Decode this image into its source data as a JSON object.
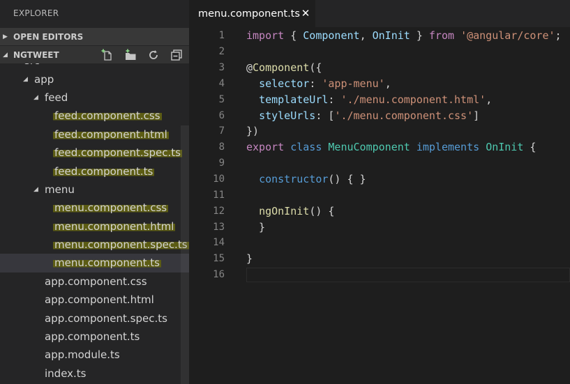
{
  "explorer": {
    "title": "EXPLORER",
    "open_editors": "OPEN EDITORS",
    "project": "NGTWEET",
    "actions": [
      "new-file-icon",
      "new-folder-icon",
      "refresh-icon",
      "collapse-all-icon"
    ]
  },
  "tree": [
    {
      "name": "src",
      "kind": "folder",
      "depth": 0
    },
    {
      "name": "app",
      "kind": "folder",
      "depth": 1
    },
    {
      "name": "feed",
      "kind": "folder",
      "depth": 2
    },
    {
      "name": "feed.component.css",
      "kind": "file",
      "depth": 3,
      "highlight": true
    },
    {
      "name": "feed.component.html",
      "kind": "file",
      "depth": 3,
      "highlight": true
    },
    {
      "name": "feed.component.spec.ts",
      "kind": "file",
      "depth": 3,
      "highlight": true
    },
    {
      "name": "feed.component.ts",
      "kind": "file",
      "depth": 3,
      "highlight": true
    },
    {
      "name": "menu",
      "kind": "folder",
      "depth": 2
    },
    {
      "name": "menu.component.css",
      "kind": "file",
      "depth": 3,
      "highlight": true
    },
    {
      "name": "menu.component.html",
      "kind": "file",
      "depth": 3,
      "highlight": true
    },
    {
      "name": "menu.component.spec.ts",
      "kind": "file",
      "depth": 3,
      "highlight": true
    },
    {
      "name": "menu.component.ts",
      "kind": "file",
      "depth": 3,
      "highlight": true,
      "selected": true
    },
    {
      "name": "app.component.css",
      "kind": "file",
      "depth": 2
    },
    {
      "name": "app.component.html",
      "kind": "file",
      "depth": 2
    },
    {
      "name": "app.component.spec.ts",
      "kind": "file",
      "depth": 2
    },
    {
      "name": "app.component.ts",
      "kind": "file",
      "depth": 2
    },
    {
      "name": "app.module.ts",
      "kind": "file",
      "depth": 2
    },
    {
      "name": "index.ts",
      "kind": "file",
      "depth": 2
    }
  ],
  "editor": {
    "tab_label": "menu.component.ts",
    "close_icon": "close-icon",
    "current_line": 16,
    "lines": [
      [
        [
          "import",
          "p"
        ],
        [
          " { ",
          "d"
        ],
        [
          "Component",
          "v"
        ],
        [
          ", ",
          "d"
        ],
        [
          "OnInit",
          "v"
        ],
        [
          " } ",
          "d"
        ],
        [
          "from",
          "p"
        ],
        [
          " ",
          "d"
        ],
        [
          "'@angular/core'",
          "s"
        ],
        [
          ";",
          "d"
        ]
      ],
      [],
      [
        [
          "@",
          "d"
        ],
        [
          "Component",
          "f"
        ],
        [
          "({",
          "d"
        ]
      ],
      [
        [
          "  ",
          "d"
        ],
        [
          "selector",
          "v"
        ],
        [
          ": ",
          "d"
        ],
        [
          "'app-menu'",
          "s"
        ],
        [
          ",",
          "d"
        ]
      ],
      [
        [
          "  ",
          "d"
        ],
        [
          "templateUrl",
          "v"
        ],
        [
          ": ",
          "d"
        ],
        [
          "'./menu.component.html'",
          "s"
        ],
        [
          ",",
          "d"
        ]
      ],
      [
        [
          "  ",
          "d"
        ],
        [
          "styleUrls",
          "v"
        ],
        [
          ": [",
          "d"
        ],
        [
          "'./menu.component.css'",
          "s"
        ],
        [
          "]",
          "d"
        ]
      ],
      [
        [
          "})",
          "d"
        ]
      ],
      [
        [
          "export",
          "p"
        ],
        [
          " ",
          "d"
        ],
        [
          "class",
          "k"
        ],
        [
          " ",
          "d"
        ],
        [
          "MenuComponent",
          "t"
        ],
        [
          " ",
          "d"
        ],
        [
          "implements",
          "k"
        ],
        [
          " ",
          "d"
        ],
        [
          "OnInit",
          "t"
        ],
        [
          " {",
          "d"
        ]
      ],
      [],
      [
        [
          "  ",
          "d"
        ],
        [
          "constructor",
          "k"
        ],
        [
          "() { }",
          "d"
        ]
      ],
      [],
      [
        [
          "  ",
          "d"
        ],
        [
          "ngOnInit",
          "f"
        ],
        [
          "() {",
          "d"
        ]
      ],
      [
        [
          "  }",
          "d"
        ]
      ],
      [],
      [
        [
          "}",
          "d"
        ]
      ],
      []
    ]
  }
}
